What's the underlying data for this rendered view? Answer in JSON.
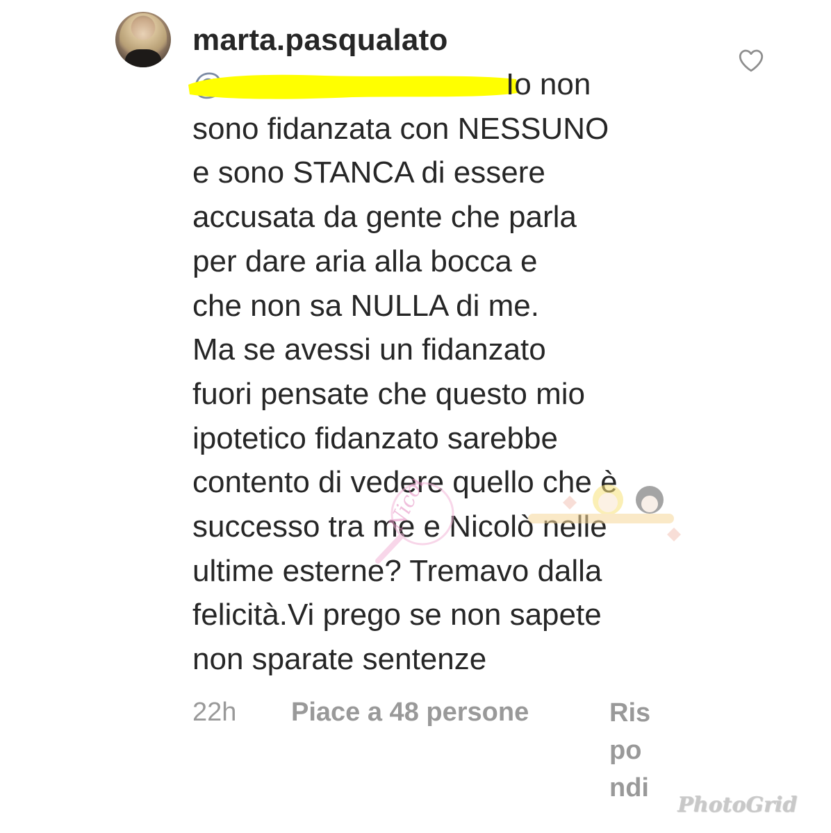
{
  "comment": {
    "username": "marta.pasqualato",
    "avatar_icon": "profile-photo-avatar",
    "like_icon": "heart-outline-icon",
    "mention_text": "@",
    "mention_tail": "Io non",
    "lines": [
      "sono fidanzata con NESSUNO",
      "e sono STANCA di essere",
      "accusata da gente che parla",
      "per dare aria alla bocca e",
      "che non sa NULLA di me.",
      "Ma se avessi un fidanzato",
      "fuori pensate che questo mio",
      "ipotetico fidanzato sarebbe",
      "contento di vedere quello che è",
      "successo tra me e Nicolò nelle",
      "ultime esterne? Tremavo dalla",
      "felicità.Vi prego se non sapete",
      "non sparate sentenze"
    ],
    "redaction_color": "#ffff00"
  },
  "meta": {
    "time": "22h",
    "likes": "Piace a 48 persone",
    "reply_parts": [
      "Ris",
      "po",
      "ndi"
    ]
  },
  "watermarks": {
    "center_script": "Nicolò Kiss",
    "corner": "PhotoGrid"
  }
}
